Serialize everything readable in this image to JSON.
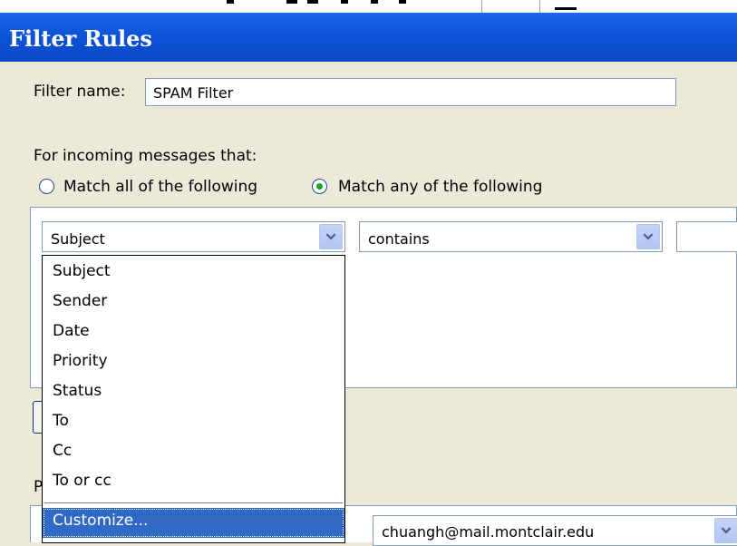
{
  "window": {
    "title": "Filter Rules"
  },
  "filter_name": {
    "label": "Filter name:",
    "value": "SPAM Filter"
  },
  "incoming": {
    "label": "For incoming messages that:",
    "match_all_label": "Match all of the following",
    "match_any_label": "Match any of the following",
    "selected": "match_any"
  },
  "rule": {
    "field_value": "Subject",
    "operator_value": "contains",
    "value_text": ""
  },
  "field_dropdown": {
    "items": [
      "Subject",
      "Sender",
      "Date",
      "Priority",
      "Status",
      "To",
      "Cc",
      "To or cc"
    ],
    "customize_label": "Customize...",
    "highlighted": "Customize..."
  },
  "lower": {
    "fragment_letter": "P",
    "account_value": "chuangh@mail.montclair.edu"
  },
  "icons": {
    "combo_arrow": "chevron-down-icon"
  },
  "colors": {
    "titlebar": "#0b52d6",
    "selection": "#316ac5",
    "dialog_bg": "#ece9d8",
    "radio_dot": "#21a121"
  }
}
